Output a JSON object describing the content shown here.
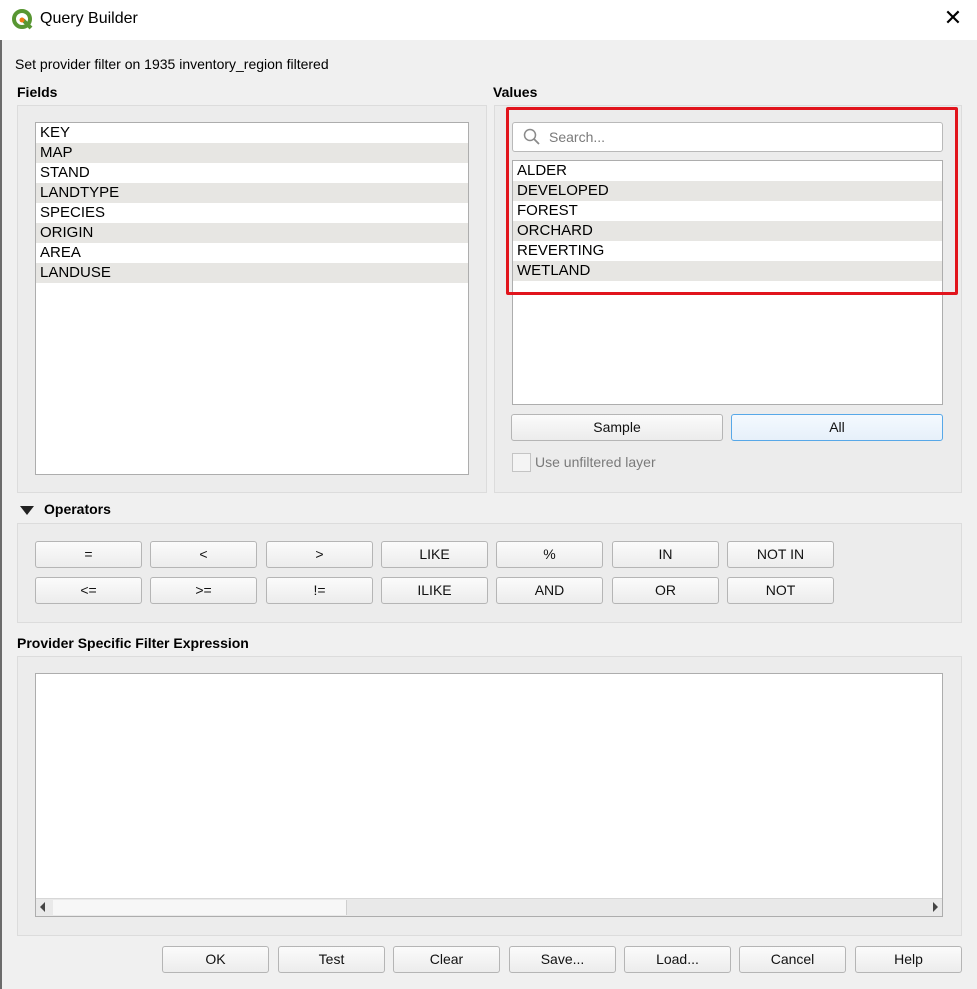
{
  "window": {
    "title": "Query Builder",
    "close_glyph": "✕"
  },
  "subtitle": "Set provider filter on 1935 inventory_region filtered",
  "fields": {
    "label": "Fields",
    "items": [
      "KEY",
      "MAP",
      "STAND",
      "LANDTYPE",
      "SPECIES",
      "ORIGIN",
      "AREA",
      "LANDUSE"
    ]
  },
  "values": {
    "label": "Values",
    "search_placeholder": "Search...",
    "items": [
      "ALDER",
      "DEVELOPED",
      "FOREST",
      "ORCHARD",
      "REVERTING",
      "WETLAND"
    ],
    "sample_button": "Sample",
    "all_button": "All",
    "use_unfiltered_label": "Use unfiltered layer",
    "use_unfiltered_checked": false,
    "highlight_color": "#e1141c"
  },
  "operators": {
    "label": "Operators",
    "row1": [
      "=",
      "<",
      ">",
      "LIKE",
      "%",
      "IN",
      "NOT IN"
    ],
    "row2": [
      "<=",
      ">=",
      "!=",
      "ILIKE",
      "AND",
      "OR",
      "NOT"
    ]
  },
  "expression": {
    "label": "Provider Specific Filter Expression",
    "value": ""
  },
  "footer": {
    "ok": "OK",
    "test": "Test",
    "clear": "Clear",
    "save": "Save...",
    "load": "Load...",
    "cancel": "Cancel",
    "help": "Help"
  }
}
